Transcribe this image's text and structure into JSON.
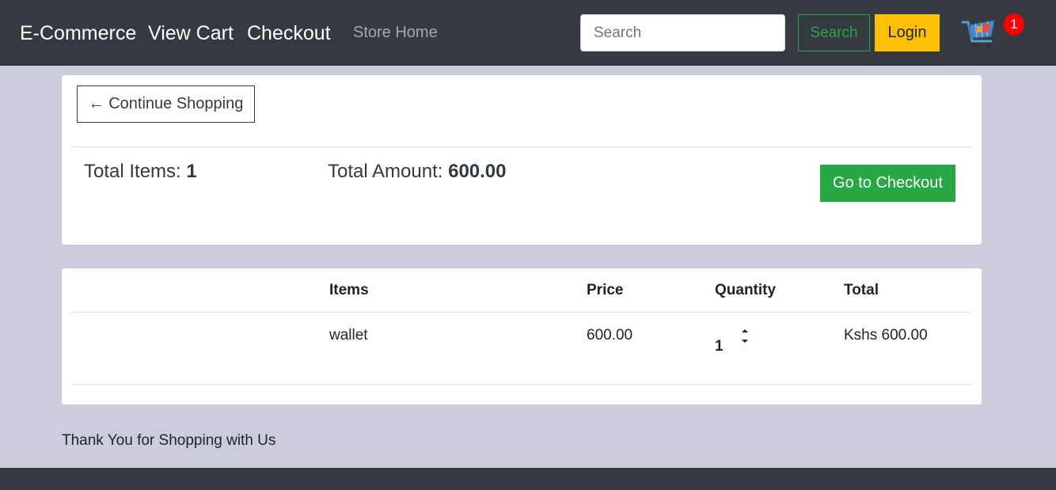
{
  "nav": {
    "brand": "E-Commerce",
    "view_cart": "View Cart",
    "checkout": "Checkout",
    "store_home": "Store Home",
    "search_placeholder": "Search",
    "search_button": "Search",
    "login_button": "Login",
    "cart_count": "1",
    "cart_icon": "shopping-cart-icon"
  },
  "summary": {
    "continue_label": "← Continue Shopping",
    "total_items_label": "Total Items: ",
    "total_items_value": "1",
    "total_amount_label": "Total Amount: ",
    "total_amount_value": "600.00",
    "checkout_button": "Go to Checkout"
  },
  "table": {
    "headers": [
      "Items",
      "Price",
      "Quantity",
      "Total"
    ],
    "rows": [
      {
        "item": "wallet",
        "price": "600.00",
        "quantity": "1",
        "total": "Kshs 600.00"
      }
    ]
  },
  "footer": {
    "thanks": "Thank You for Shopping with Us"
  },
  "colors": {
    "navbar": "#343a40",
    "page_bg": "#ccccdc",
    "success": "#28a745",
    "warning": "#ffc107",
    "badge": "#ff0000"
  }
}
